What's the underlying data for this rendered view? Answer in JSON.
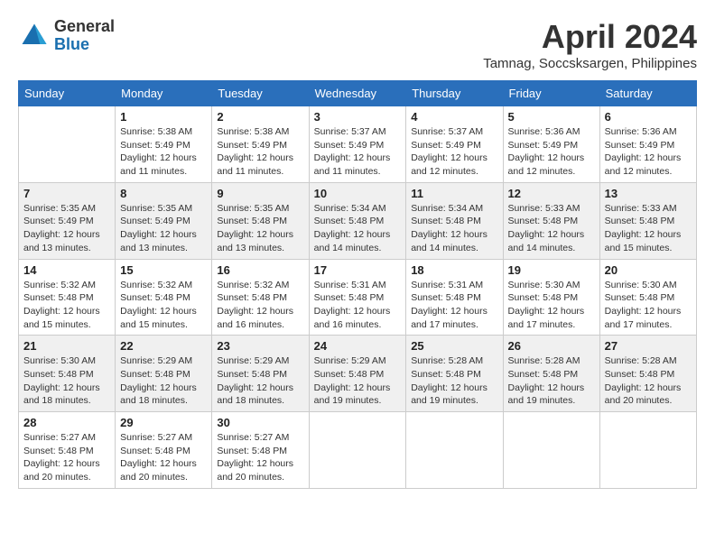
{
  "header": {
    "logo_general": "General",
    "logo_blue": "Blue",
    "month": "April 2024",
    "location": "Tamnag, Soccsksargen, Philippines"
  },
  "days_of_week": [
    "Sunday",
    "Monday",
    "Tuesday",
    "Wednesday",
    "Thursday",
    "Friday",
    "Saturday"
  ],
  "weeks": [
    [
      {
        "day": "",
        "info": ""
      },
      {
        "day": "1",
        "info": "Sunrise: 5:38 AM\nSunset: 5:49 PM\nDaylight: 12 hours\nand 11 minutes."
      },
      {
        "day": "2",
        "info": "Sunrise: 5:38 AM\nSunset: 5:49 PM\nDaylight: 12 hours\nand 11 minutes."
      },
      {
        "day": "3",
        "info": "Sunrise: 5:37 AM\nSunset: 5:49 PM\nDaylight: 12 hours\nand 11 minutes."
      },
      {
        "day": "4",
        "info": "Sunrise: 5:37 AM\nSunset: 5:49 PM\nDaylight: 12 hours\nand 12 minutes."
      },
      {
        "day": "5",
        "info": "Sunrise: 5:36 AM\nSunset: 5:49 PM\nDaylight: 12 hours\nand 12 minutes."
      },
      {
        "day": "6",
        "info": "Sunrise: 5:36 AM\nSunset: 5:49 PM\nDaylight: 12 hours\nand 12 minutes."
      }
    ],
    [
      {
        "day": "7",
        "info": "Sunrise: 5:35 AM\nSunset: 5:49 PM\nDaylight: 12 hours\nand 13 minutes."
      },
      {
        "day": "8",
        "info": "Sunrise: 5:35 AM\nSunset: 5:49 PM\nDaylight: 12 hours\nand 13 minutes."
      },
      {
        "day": "9",
        "info": "Sunrise: 5:35 AM\nSunset: 5:48 PM\nDaylight: 12 hours\nand 13 minutes."
      },
      {
        "day": "10",
        "info": "Sunrise: 5:34 AM\nSunset: 5:48 PM\nDaylight: 12 hours\nand 14 minutes."
      },
      {
        "day": "11",
        "info": "Sunrise: 5:34 AM\nSunset: 5:48 PM\nDaylight: 12 hours\nand 14 minutes."
      },
      {
        "day": "12",
        "info": "Sunrise: 5:33 AM\nSunset: 5:48 PM\nDaylight: 12 hours\nand 14 minutes."
      },
      {
        "day": "13",
        "info": "Sunrise: 5:33 AM\nSunset: 5:48 PM\nDaylight: 12 hours\nand 15 minutes."
      }
    ],
    [
      {
        "day": "14",
        "info": "Sunrise: 5:32 AM\nSunset: 5:48 PM\nDaylight: 12 hours\nand 15 minutes."
      },
      {
        "day": "15",
        "info": "Sunrise: 5:32 AM\nSunset: 5:48 PM\nDaylight: 12 hours\nand 15 minutes."
      },
      {
        "day": "16",
        "info": "Sunrise: 5:32 AM\nSunset: 5:48 PM\nDaylight: 12 hours\nand 16 minutes."
      },
      {
        "day": "17",
        "info": "Sunrise: 5:31 AM\nSunset: 5:48 PM\nDaylight: 12 hours\nand 16 minutes."
      },
      {
        "day": "18",
        "info": "Sunrise: 5:31 AM\nSunset: 5:48 PM\nDaylight: 12 hours\nand 17 minutes."
      },
      {
        "day": "19",
        "info": "Sunrise: 5:30 AM\nSunset: 5:48 PM\nDaylight: 12 hours\nand 17 minutes."
      },
      {
        "day": "20",
        "info": "Sunrise: 5:30 AM\nSunset: 5:48 PM\nDaylight: 12 hours\nand 17 minutes."
      }
    ],
    [
      {
        "day": "21",
        "info": "Sunrise: 5:30 AM\nSunset: 5:48 PM\nDaylight: 12 hours\nand 18 minutes."
      },
      {
        "day": "22",
        "info": "Sunrise: 5:29 AM\nSunset: 5:48 PM\nDaylight: 12 hours\nand 18 minutes."
      },
      {
        "day": "23",
        "info": "Sunrise: 5:29 AM\nSunset: 5:48 PM\nDaylight: 12 hours\nand 18 minutes."
      },
      {
        "day": "24",
        "info": "Sunrise: 5:29 AM\nSunset: 5:48 PM\nDaylight: 12 hours\nand 19 minutes."
      },
      {
        "day": "25",
        "info": "Sunrise: 5:28 AM\nSunset: 5:48 PM\nDaylight: 12 hours\nand 19 minutes."
      },
      {
        "day": "26",
        "info": "Sunrise: 5:28 AM\nSunset: 5:48 PM\nDaylight: 12 hours\nand 19 minutes."
      },
      {
        "day": "27",
        "info": "Sunrise: 5:28 AM\nSunset: 5:48 PM\nDaylight: 12 hours\nand 20 minutes."
      }
    ],
    [
      {
        "day": "28",
        "info": "Sunrise: 5:27 AM\nSunset: 5:48 PM\nDaylight: 12 hours\nand 20 minutes."
      },
      {
        "day": "29",
        "info": "Sunrise: 5:27 AM\nSunset: 5:48 PM\nDaylight: 12 hours\nand 20 minutes."
      },
      {
        "day": "30",
        "info": "Sunrise: 5:27 AM\nSunset: 5:48 PM\nDaylight: 12 hours\nand 20 minutes."
      },
      {
        "day": "",
        "info": ""
      },
      {
        "day": "",
        "info": ""
      },
      {
        "day": "",
        "info": ""
      },
      {
        "day": "",
        "info": ""
      }
    ]
  ]
}
